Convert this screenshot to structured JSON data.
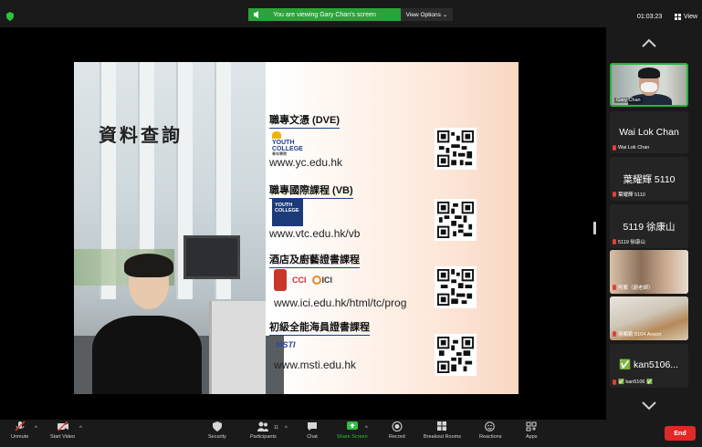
{
  "top_bar": {
    "viewing_text": "You are viewing Gary Chan's screen",
    "view_options_label": "View Options",
    "timer": "01:03:23",
    "view_label": "View"
  },
  "slide": {
    "title": "資料查詢",
    "sections": [
      {
        "heading": "職專文憑 (DVE)",
        "logo_text": "YOUTH COLLEGE",
        "logo_sub": "青年學院",
        "url": "www.yc.edu.hk"
      },
      {
        "heading": "職專國際課程 (VB)",
        "logo_text": "YOUTH COLLEGE",
        "url": "www.vtc.edu.hk/vb"
      },
      {
        "heading": "酒店及廚藝證書課程",
        "logo_cci": "CCI",
        "logo_ici": "ICI",
        "url": "www.ici.edu.hk/html/tc/prog"
      },
      {
        "heading": "初級全能海員證書課程",
        "logo_text": "MSTI",
        "url": "www.msti.edu.hk"
      }
    ]
  },
  "participants": [
    {
      "name": "Gary Chan",
      "type": "video"
    },
    {
      "big": "Wai Lok Chan",
      "name": "Wai Lok Chan",
      "muted": true
    },
    {
      "big": "葉耀輝 5110",
      "name": "葉耀輝 5110",
      "muted": true
    },
    {
      "big": "5119 徐康山",
      "name": "5119 徐康山",
      "muted": true
    },
    {
      "name": "阿紫（趙老師）",
      "muted": true,
      "type": "video"
    },
    {
      "name": "張顯勤 5104 Anson",
      "muted": true,
      "type": "video"
    },
    {
      "big": "✅ kan5106...",
      "name": "✅ kan5106 ✅",
      "muted": true
    }
  ],
  "toolbar": {
    "unmute": "Unmute",
    "start_video": "Start Video",
    "security": "Security",
    "participants": "Participants",
    "participants_count": "11",
    "chat": "Chat",
    "share_screen": "Share Screen",
    "record": "Record",
    "breakout_rooms": "Breakout Rooms",
    "reactions": "Reactions",
    "apps": "Apps",
    "end": "End"
  },
  "colors": {
    "green": "#2ba33a",
    "end_red": "#e02828",
    "link_blue": "#1c3f8c"
  }
}
